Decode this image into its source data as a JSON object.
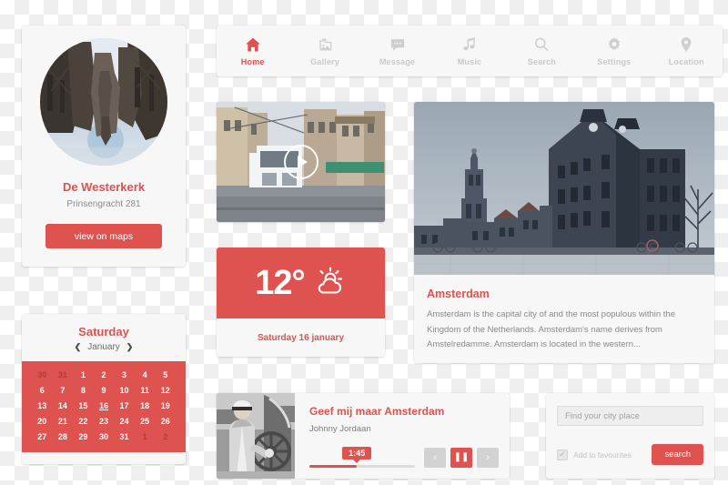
{
  "theme": {
    "accent": "#de524f",
    "card_bg": "#f7f7f7",
    "muted_text": "#8c8c8c"
  },
  "nav": {
    "items": [
      {
        "label": "Home",
        "icon": "home-icon",
        "active": true
      },
      {
        "label": "Gallery",
        "icon": "gallery-icon",
        "active": false
      },
      {
        "label": "Message",
        "icon": "message-icon",
        "active": false
      },
      {
        "label": "Music",
        "icon": "music-icon",
        "active": false
      },
      {
        "label": "Search",
        "icon": "search-icon",
        "active": false
      },
      {
        "label": "Settings",
        "icon": "settings-icon",
        "active": false
      },
      {
        "label": "Location",
        "icon": "location-icon",
        "active": false
      }
    ]
  },
  "profile": {
    "avatar_alt": "canal-reflection-photo",
    "name": "De Westerkerk",
    "address": "Prinsengracht 281",
    "button_label": "view on maps"
  },
  "calendar": {
    "day_name": "Saturday",
    "month": "January",
    "prev_icon": "chevron-left-icon",
    "next_icon": "chevron-right-icon",
    "selected_day": 16,
    "weeks": [
      [
        {
          "d": 30,
          "m": true
        },
        {
          "d": 31,
          "m": true
        },
        {
          "d": 1
        },
        {
          "d": 2
        },
        {
          "d": 3
        },
        {
          "d": 4
        },
        {
          "d": 5
        }
      ],
      [
        {
          "d": 6
        },
        {
          "d": 7
        },
        {
          "d": 8
        },
        {
          "d": 9
        },
        {
          "d": 10
        },
        {
          "d": 11
        },
        {
          "d": 12
        }
      ],
      [
        {
          "d": 13
        },
        {
          "d": 14
        },
        {
          "d": 15
        },
        {
          "d": 16,
          "t": true
        },
        {
          "d": 17
        },
        {
          "d": 18
        },
        {
          "d": 19
        }
      ],
      [
        {
          "d": 20
        },
        {
          "d": 21
        },
        {
          "d": 22
        },
        {
          "d": 23
        },
        {
          "d": 24
        },
        {
          "d": 25
        },
        {
          "d": 26
        }
      ],
      [
        {
          "d": 27
        },
        {
          "d": 28
        },
        {
          "d": 29
        },
        {
          "d": 30
        },
        {
          "d": 31
        },
        {
          "d": 1,
          "m": true
        },
        {
          "d": 2,
          "m": true
        }
      ]
    ]
  },
  "video": {
    "alt": "amsterdam-tram-street-scene",
    "play_icon": "play-icon"
  },
  "weather": {
    "temperature": "12°",
    "icon": "sun-cloud-icon",
    "date": "Saturday 16 january"
  },
  "feature": {
    "image_alt": "amsterdam-winter-building-photo",
    "title": "Amsterdam",
    "description": "Amsterdam is the capital city of and the most populous within the Kingdom of the Netherlands. Amsterdam's name derives from Amstelredamme. Amsterdam is located in the western..."
  },
  "player": {
    "thumb_alt": "johnny-jordaan-portrait",
    "title": "Geef mij maar Amsterdam",
    "artist": "Johnny Jordaan",
    "current_time": "1:45",
    "progress_percent": 45,
    "prev_label": "‹",
    "pause_label": "❚❚",
    "next_label": "›"
  },
  "search": {
    "placeholder": "Find your city place",
    "value": "",
    "favourite_label": "Add to favourites",
    "favourite_checked": true,
    "check_glyph": "✓",
    "button_label": "search"
  }
}
